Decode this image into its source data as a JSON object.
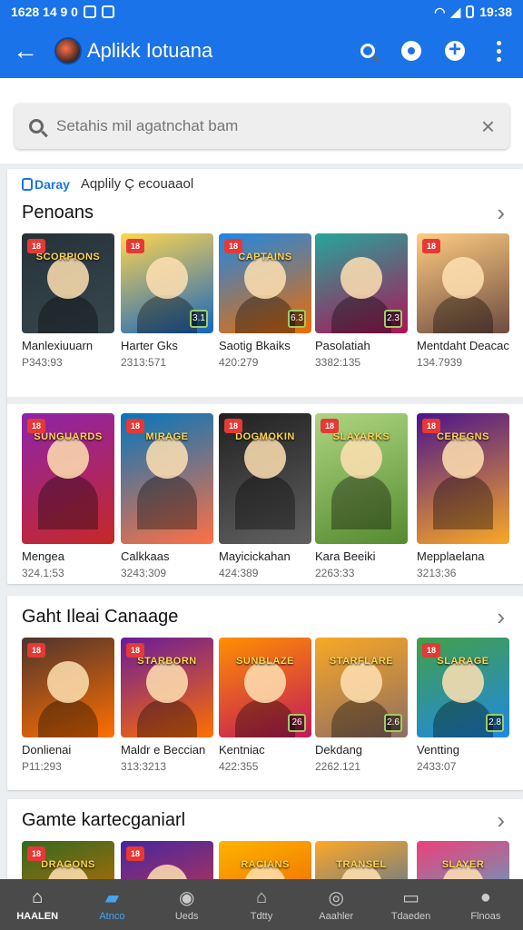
{
  "status": {
    "left_text": "1628 14 9 0",
    "right_text": "19:38"
  },
  "appbar": {
    "back": "←",
    "title": "Aplikk Iotuana"
  },
  "search": {
    "placeholder": "Setahis mil agatnchat bam",
    "clear": "×"
  },
  "card1": {
    "chip": "Daray",
    "subtitle": "Aqplily Ç ecouaaol",
    "section_title": "Penoans",
    "chevron": "›",
    "tiles": [
      {
        "name": "Manlexiuuarn",
        "num": "P343:93",
        "badge": "18",
        "rank": "",
        "colors": [
          "#263238",
          "#37474f"
        ],
        "logo": "SCORPIONS"
      },
      {
        "name": "Harter Gks",
        "num": "2313:571",
        "badge": "18",
        "rank": "3.1",
        "colors": [
          "#ffd54f",
          "#1565c0"
        ],
        "logo": ""
      },
      {
        "name": "Saotig Bkaiks",
        "num": "420:279",
        "badge": "18",
        "rank": "6.3",
        "colors": [
          "#1e88e5",
          "#ef6c00"
        ],
        "logo": "CAPTAINS"
      },
      {
        "name": "Pasolatiah",
        "num": "3382:135",
        "badge": "",
        "rank": "2.3",
        "colors": [
          "#26a69a",
          "#ad1457"
        ],
        "logo": ""
      },
      {
        "name": "Mentdaht Deacacan",
        "num": "134.7939",
        "badge": "18",
        "rank": "",
        "colors": [
          "#ffcc80",
          "#6d4c41"
        ],
        "logo": ""
      }
    ],
    "tiles2": [
      {
        "name": "Mengea",
        "num": "324.1:53",
        "badge": "18",
        "rank": "",
        "colors": [
          "#8e24aa",
          "#c62828"
        ],
        "logo": "SUNGUARDS"
      },
      {
        "name": "Calkkaas",
        "num": "3243:309",
        "badge": "18",
        "rank": "",
        "colors": [
          "#0277bd",
          "#ff7043"
        ],
        "logo": "MIRAGE"
      },
      {
        "name": "Mayicickahan",
        "num": "424:389",
        "badge": "18",
        "rank": "",
        "colors": [
          "#212121",
          "#616161"
        ],
        "logo": "DOGMOKIN"
      },
      {
        "name": "Kara Beeiki",
        "num": "2263:33",
        "badge": "18",
        "rank": "",
        "colors": [
          "#aed581",
          "#558b2f"
        ],
        "logo": "SLAYARKS"
      },
      {
        "name": "Mepplaelana",
        "num": "3213:36",
        "badge": "18",
        "rank": "",
        "colors": [
          "#4a148c",
          "#f9a825"
        ],
        "logo": "CEREGNS"
      }
    ]
  },
  "card2": {
    "section_title": "Gaht Ileai Canaage",
    "chevron": "›",
    "tiles": [
      {
        "name": "Donlienai",
        "num": "P11:293",
        "badge": "18",
        "rank": "",
        "colors": [
          "#4e342e",
          "#ff6f00"
        ],
        "logo": ""
      },
      {
        "name": "Maldr e Beccian",
        "num": "313:3213",
        "badge": "18",
        "rank": "",
        "colors": [
          "#6a1b9a",
          "#ff6f00"
        ],
        "logo": "STARBORN"
      },
      {
        "name": "Kentniac",
        "num": "422:355",
        "badge": "",
        "rank": "26",
        "colors": [
          "#ff8f00",
          "#c2185b"
        ],
        "logo": "SUNBLAZE"
      },
      {
        "name": "Dekdang",
        "num": "2262.121",
        "badge": "",
        "rank": "2.6",
        "colors": [
          "#f9a825",
          "#8d6e63"
        ],
        "logo": "STARFLARE"
      },
      {
        "name": "Ventting",
        "num": "2433:07",
        "badge": "18",
        "rank": "2.8",
        "colors": [
          "#43a047",
          "#1e88e5"
        ],
        "logo": "SLARAGE"
      }
    ]
  },
  "card3": {
    "section_title": "Gamte kartecganiarl",
    "chevron": "›",
    "tiles": [
      {
        "name": "",
        "num": "",
        "badge": "18",
        "rank": "",
        "colors": [
          "#33691e",
          "#ef6c00"
        ],
        "logo": "DRAGONS"
      },
      {
        "name": "",
        "num": "",
        "badge": "18",
        "rank": "",
        "colors": [
          "#4527a0",
          "#e53935"
        ],
        "logo": ""
      },
      {
        "name": "",
        "num": "",
        "badge": "",
        "rank": "",
        "colors": [
          "#ffb300",
          "#e65100"
        ],
        "logo": "RACIANS"
      },
      {
        "name": "",
        "num": "",
        "badge": "",
        "rank": "",
        "colors": [
          "#ffa726",
          "#1565c0"
        ],
        "logo": "TRANSEL"
      },
      {
        "name": "",
        "num": "",
        "badge": "",
        "rank": "",
        "colors": [
          "#ec407a",
          "#26c6da"
        ],
        "logo": "SLAYER"
      }
    ]
  },
  "bottomnav": [
    {
      "label": "HAALEN",
      "icon": "home-icon"
    },
    {
      "label": "Atnco",
      "icon": "store-icon"
    },
    {
      "label": "Ueds",
      "icon": "info-icon"
    },
    {
      "label": "Tdtty",
      "icon": "house-outline-icon"
    },
    {
      "label": "Aaahler",
      "icon": "compass-icon"
    },
    {
      "label": "Tdaeden",
      "icon": "folder-icon"
    },
    {
      "label": "Flnoas",
      "icon": "profile-icon"
    }
  ],
  "colors": {
    "accent": "#1a73e8",
    "nav_bg": "#4a4a4a",
    "badge": "#e53935"
  }
}
